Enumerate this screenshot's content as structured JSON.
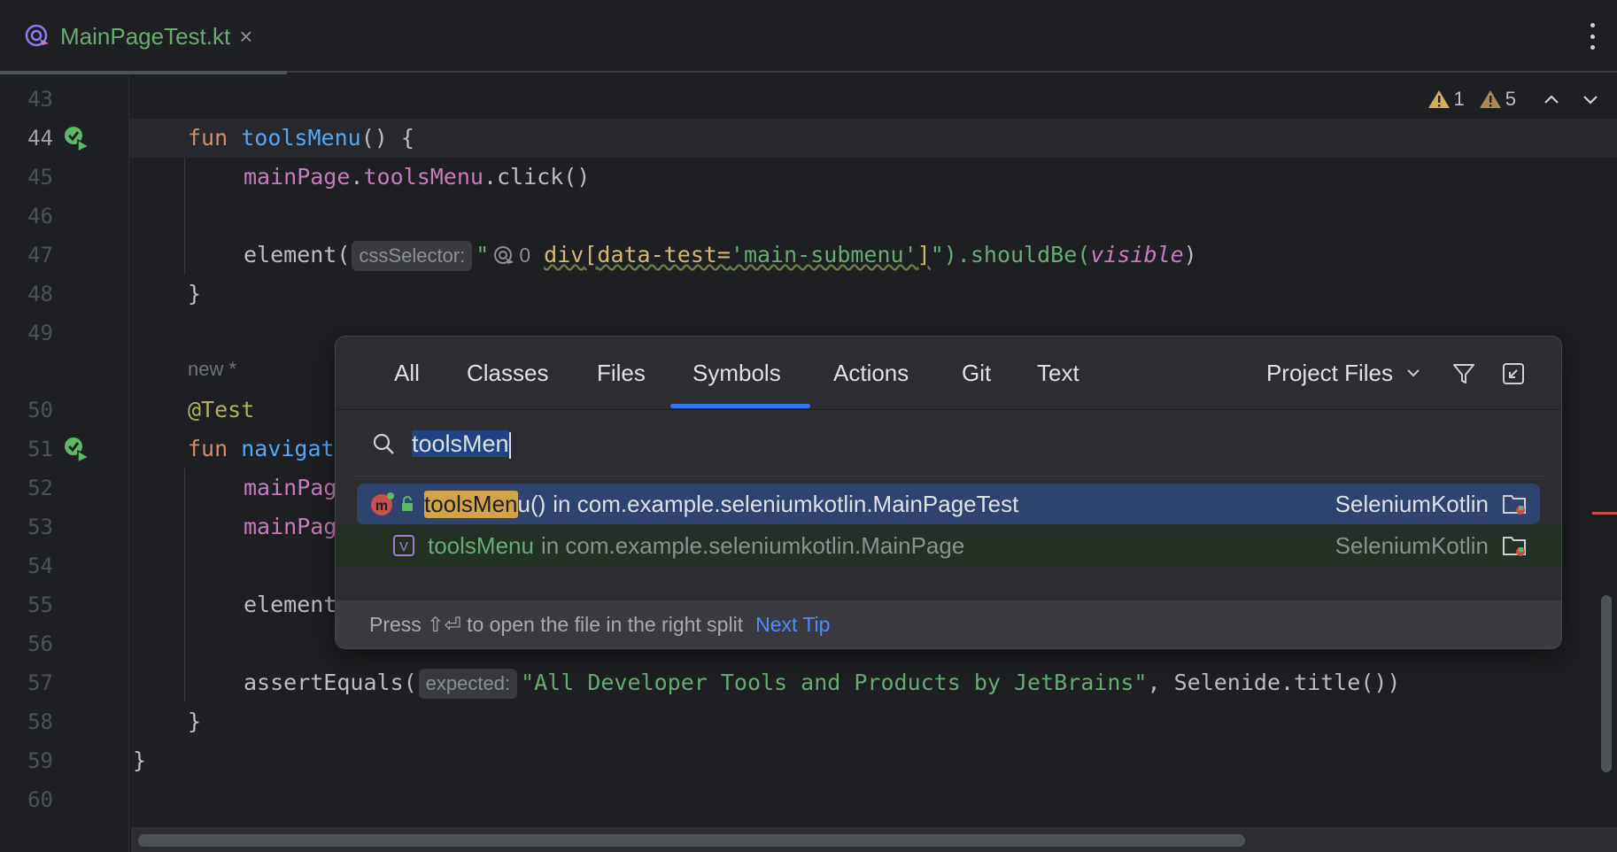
{
  "tab": {
    "title": "MainPageTest.kt",
    "close": "×"
  },
  "warnings": {
    "first_count": "1",
    "second_count": "5"
  },
  "line_numbers": [
    "43",
    "44",
    "45",
    "46",
    "47",
    "48",
    "49",
    "50",
    "51",
    "52",
    "53",
    "54",
    "55",
    "56",
    "57",
    "58",
    "59",
    "60"
  ],
  "code": {
    "l44_kw": "fun",
    "l44_fn": "toolsMenu",
    "l44_rest": "() {",
    "l45_obj": "mainPage",
    "l45_prop": "toolsMenu",
    "l45_rest": ".click()",
    "l47_call": "element(",
    "l47_hint": "cssSelector:",
    "l47_quote": "\"",
    "l47_icon_num": "0",
    "l47_sel": "div",
    "l47_br1": "[",
    "l47_attr": "data-test=",
    "l47_val": "'main-submenu'",
    "l47_br2": "]",
    "l47_end": "\").shouldBe(",
    "l47_it": "visible",
    "l47_close": ")",
    "l48": "}",
    "new_marker": "new *",
    "l50": "@Test",
    "l51_kw": "fun",
    "l51_fn": "navigat",
    "l52": "mainPag",
    "l53": "mainPag",
    "l55": "element",
    "l57_call": "assertEquals(",
    "l57_hint": "expected:",
    "l57_str": "\"All Developer Tools and Products by JetBrains\"",
    "l57_rest": ", Selenide.title())",
    "l58": "}",
    "l59": "}"
  },
  "popup": {
    "tabs": [
      "All",
      "Classes",
      "Files",
      "Symbols",
      "Actions",
      "Git",
      "Text"
    ],
    "active_tab": "Symbols",
    "scope": "Project Files",
    "search_value": "toolsMen",
    "results": [
      {
        "hl": "toolsMen",
        "rest": "u()",
        "in": "in com.example.seleniumkotlin.MainPageTest",
        "module": "SeleniumKotlin"
      },
      {
        "name": "toolsMenu",
        "in": "in com.example.seleniumkotlin.MainPage",
        "module": "SeleniumKotlin"
      }
    ],
    "footer_text": "Press ⇧⏎ to open the file in the right split",
    "footer_link": "Next Tip"
  },
  "colors": {
    "accent": "#3574f0",
    "selection": "#2e436e",
    "highlight": "#d1a34b"
  }
}
